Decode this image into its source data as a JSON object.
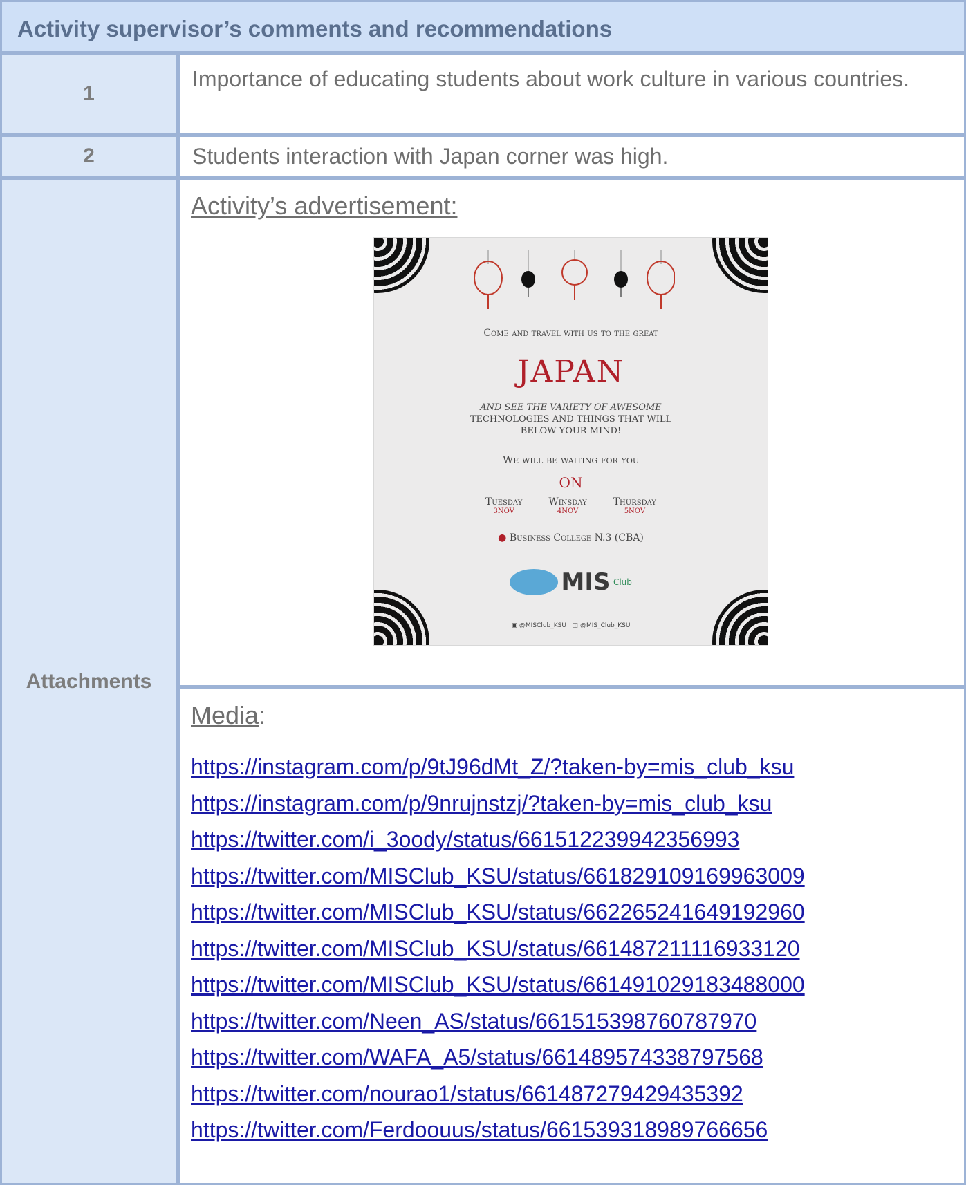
{
  "header": {
    "title": "Activity supervisor’s comments and recommendations"
  },
  "rows": [
    {
      "num": "1",
      "text": "Importance of educating students about work culture in various countries."
    },
    {
      "num": "2",
      "text": "Students interaction with Japan corner was high."
    }
  ],
  "attachments": {
    "label": "Attachments",
    "advert_heading": "Activity’s advertisement:",
    "media_heading": "Media",
    "media_colon": ":",
    "links": [
      "https://instagram.com/p/9tJ96dMt_Z/?taken-by=mis_club_ksu",
      "https://instagram.com/p/9nrujnstzj/?taken-by=mis_club_ksu",
      "https://twitter.com/i_3oody/status/661512239942356993",
      "https://twitter.com/MISClub_KSU/status/661829109169963009",
      "https://twitter.com/MISClub_KSU/status/662265241649192960",
      "https://twitter.com/MISClub_KSU/status/661487211116933120",
      "https://twitter.com/MISClub_KSU/status/661491029183488000",
      "https://twitter.com/Neen_AS/status/661515398760787970",
      "https://twitter.com/WAFA_A5/status/661489574338797568",
      "https://twitter.com/nourao1/status/661487279429435392",
      "https://twitter.com/Ferdoouus/status/661539318989766656"
    ]
  },
  "poster": {
    "line1": "Come and travel with us to the great",
    "japan": "JAPAN",
    "line2": "and see the variety of awesome",
    "line3": "technologies and things that will",
    "line4": "below your mind!",
    "waiting": "We will be waiting for you",
    "on": "ON",
    "days": [
      {
        "day": "Tuesday",
        "date": "3NOV"
      },
      {
        "day": "Winsday",
        "date": "4NOV"
      },
      {
        "day": "Thursday",
        "date": "5NOV"
      }
    ],
    "location": "Business College N.3 (CBA)",
    "logo": "MIS",
    "logo_sub": "Club",
    "handle_twitter": "@MISClub_KSU",
    "handle_instagram": "@MIS_Club_KSU"
  }
}
